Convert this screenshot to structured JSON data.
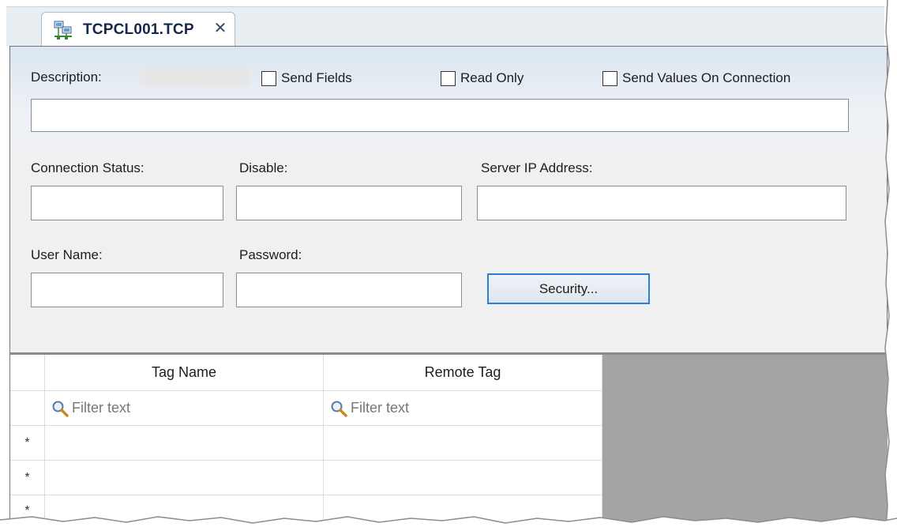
{
  "tab": {
    "title": "TCPCL001.TCP",
    "close_glyph": "✕",
    "icon": "network-computers-icon"
  },
  "form": {
    "description_label": "Description:",
    "description_value": "",
    "checkboxes": [
      {
        "label": "Send Fields",
        "checked": false
      },
      {
        "label": "Read Only",
        "checked": false
      },
      {
        "label": "Send Values On Connection",
        "checked": false
      }
    ],
    "connection_status_label": "Connection Status:",
    "connection_status_value": "",
    "disable_label": "Disable:",
    "disable_value": "",
    "server_ip_label": "Server IP Address:",
    "server_ip_value": "",
    "user_name_label": "User Name:",
    "user_name_value": "",
    "password_label": "Password:",
    "password_value": "",
    "security_button": "Security..."
  },
  "grid": {
    "columns": [
      "Tag Name",
      "Remote Tag"
    ],
    "filter_placeholder": "Filter text",
    "filter_icon": "magnifier-icon",
    "new_row_marker": "*",
    "rows": [
      {
        "marker": "*",
        "tag_name": "",
        "remote_tag": ""
      },
      {
        "marker": "*",
        "tag_name": "",
        "remote_tag": ""
      },
      {
        "marker": "*",
        "tag_name": "",
        "remote_tag": ""
      }
    ]
  },
  "colors": {
    "accent_border": "#2f7fd1",
    "tab_title": "#14284a",
    "empty_grid_background": "#a4a4a4"
  }
}
